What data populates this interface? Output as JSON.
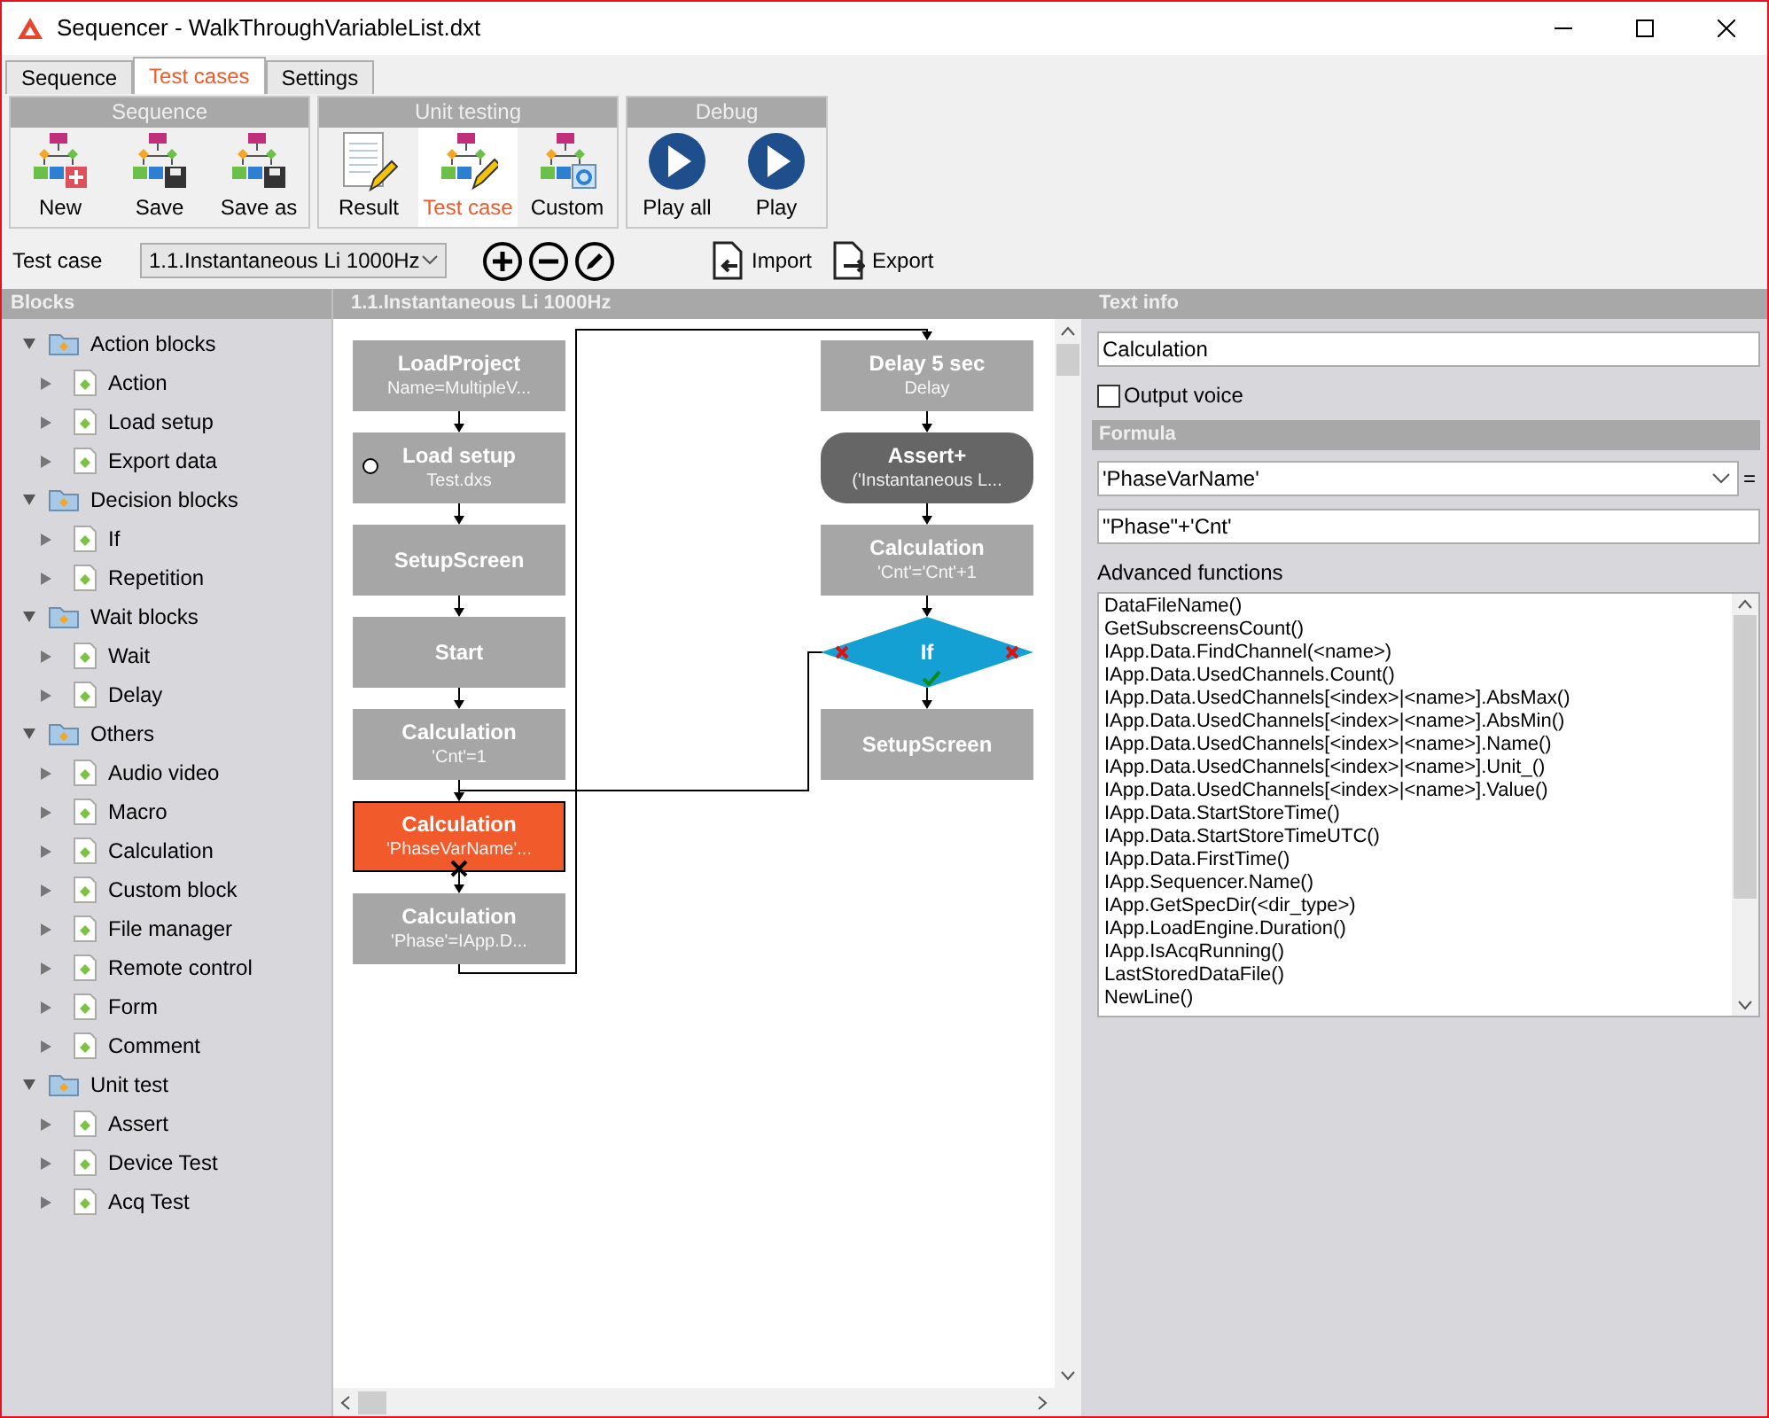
{
  "window": {
    "title": "Sequencer - WalkThroughVariableList.dxt"
  },
  "tabs": [
    {
      "label": "Sequence",
      "selected": false
    },
    {
      "label": "Test cases",
      "selected": true
    },
    {
      "label": "Settings",
      "selected": false
    }
  ],
  "ribbon": [
    {
      "title": "Sequence",
      "buttons": [
        {
          "label": "New",
          "kind": "new",
          "selected": false
        },
        {
          "label": "Save",
          "kind": "save",
          "selected": false
        },
        {
          "label": "Save as",
          "kind": "save",
          "selected": false
        }
      ]
    },
    {
      "title": "Unit testing",
      "buttons": [
        {
          "label": "Result",
          "kind": "result",
          "selected": false
        },
        {
          "label": "Test case",
          "kind": "edit",
          "selected": true
        },
        {
          "label": "Custom",
          "kind": "custom",
          "selected": false
        }
      ]
    },
    {
      "title": "Debug",
      "buttons": [
        {
          "label": "Play all",
          "kind": "play",
          "selected": false
        },
        {
          "label": "Play",
          "kind": "play",
          "selected": false
        }
      ]
    }
  ],
  "test_case_bar": {
    "label": "Test case",
    "value": "1.1.Instantaneous Li 1000Hz",
    "actions": [
      {
        "label": "Import",
        "kind": "import"
      },
      {
        "label": "Export",
        "kind": "export"
      }
    ]
  },
  "blocks_panel": {
    "title": "Blocks",
    "tree": [
      {
        "label": "Action blocks",
        "expanded": true,
        "children": [
          {
            "label": "Action",
            "expanded": false
          },
          {
            "label": "Load setup",
            "expanded": false
          },
          {
            "label": "Export data",
            "expanded": false
          }
        ]
      },
      {
        "label": "Decision blocks",
        "expanded": true,
        "children": [
          {
            "label": "If",
            "expanded": false
          },
          {
            "label": "Repetition",
            "expanded": false
          }
        ]
      },
      {
        "label": "Wait blocks",
        "expanded": true,
        "children": [
          {
            "label": "Wait",
            "expanded": false
          },
          {
            "label": "Delay",
            "expanded": false
          }
        ]
      },
      {
        "label": "Others",
        "expanded": true,
        "children": [
          {
            "label": "Audio video",
            "expanded": false
          },
          {
            "label": "Macro",
            "expanded": false
          },
          {
            "label": "Calculation",
            "expanded": false
          },
          {
            "label": "Custom block",
            "expanded": false
          },
          {
            "label": "File manager",
            "expanded": false
          },
          {
            "label": "Remote control",
            "expanded": false
          },
          {
            "label": "Form",
            "expanded": false
          },
          {
            "label": "Comment",
            "expanded": false
          }
        ]
      },
      {
        "label": "Unit test",
        "expanded": true,
        "children": [
          {
            "label": "Assert",
            "expanded": false
          },
          {
            "label": "Device Test",
            "expanded": false
          },
          {
            "label": "Acq Test",
            "expanded": false
          }
        ]
      }
    ]
  },
  "canvas": {
    "title": "1.1.Instantaneous Li 1000Hz",
    "columns": [
      [
        {
          "title": "LoadProject",
          "subtitle": "Name=MultipleV...",
          "kind": "process",
          "selected": false
        },
        {
          "title": "Load setup",
          "subtitle": "Test.dxs",
          "kind": "process",
          "selected": false
        },
        {
          "title": "SetupScreen",
          "kind": "process",
          "selected": false
        },
        {
          "title": "Start",
          "kind": "process",
          "selected": false
        },
        {
          "title": "Calculation",
          "subtitle": "'Cnt'=1",
          "kind": "process",
          "selected": false
        },
        {
          "title": "Calculation",
          "subtitle": "'PhaseVarName'...",
          "kind": "process",
          "selected": true
        },
        {
          "title": "Calculation",
          "subtitle": "'Phase'=IApp.D...",
          "kind": "process",
          "selected": false
        }
      ],
      [
        {
          "title": "Delay 5 sec",
          "subtitle": "Delay",
          "kind": "process",
          "selected": false
        },
        {
          "title": "Assert+",
          "subtitle": "('Instantaneous L...",
          "kind": "terminal",
          "selected": false
        },
        {
          "title": "Calculation",
          "subtitle": "'Cnt'='Cnt'+1",
          "kind": "process",
          "selected": false
        },
        {
          "title": "If",
          "kind": "decision",
          "selected": false
        },
        {
          "title": "SetupScreen",
          "kind": "process",
          "selected": false
        }
      ]
    ]
  },
  "text_info": {
    "title": "Text info",
    "name": "Calculation",
    "output_voice": {
      "label": "Output voice",
      "checked": false
    }
  },
  "formula": {
    "title": "Formula",
    "variable": "'PhaseVarName'",
    "equals": "=",
    "expression": "\"Phase\"+'Cnt'",
    "functions_label": "Advanced functions",
    "functions": [
      "DataFileName()",
      "GetSubscreensCount()",
      "IApp.Data.FindChannel(<name>)",
      "IApp.Data.UsedChannels.Count()",
      "IApp.Data.UsedChannels[<index>|<name>].AbsMax()",
      "IApp.Data.UsedChannels[<index>|<name>].AbsMin()",
      "IApp.Data.UsedChannels[<index>|<name>].Name()",
      "IApp.Data.UsedChannels[<index>|<name>].Unit_()",
      "IApp.Data.UsedChannels[<index>|<name>].Value()",
      "IApp.Data.StartStoreTime()",
      "IApp.Data.StartStoreTimeUTC()",
      "IApp.Data.FirstTime()",
      "IApp.Sequencer.Name()",
      "IApp.GetSpecDir(<dir_type>)",
      "IApp.LoadEngine.Duration()",
      "IApp.IsAcqRunning()",
      "LastStoredDataFile()",
      "NewLine()"
    ]
  }
}
